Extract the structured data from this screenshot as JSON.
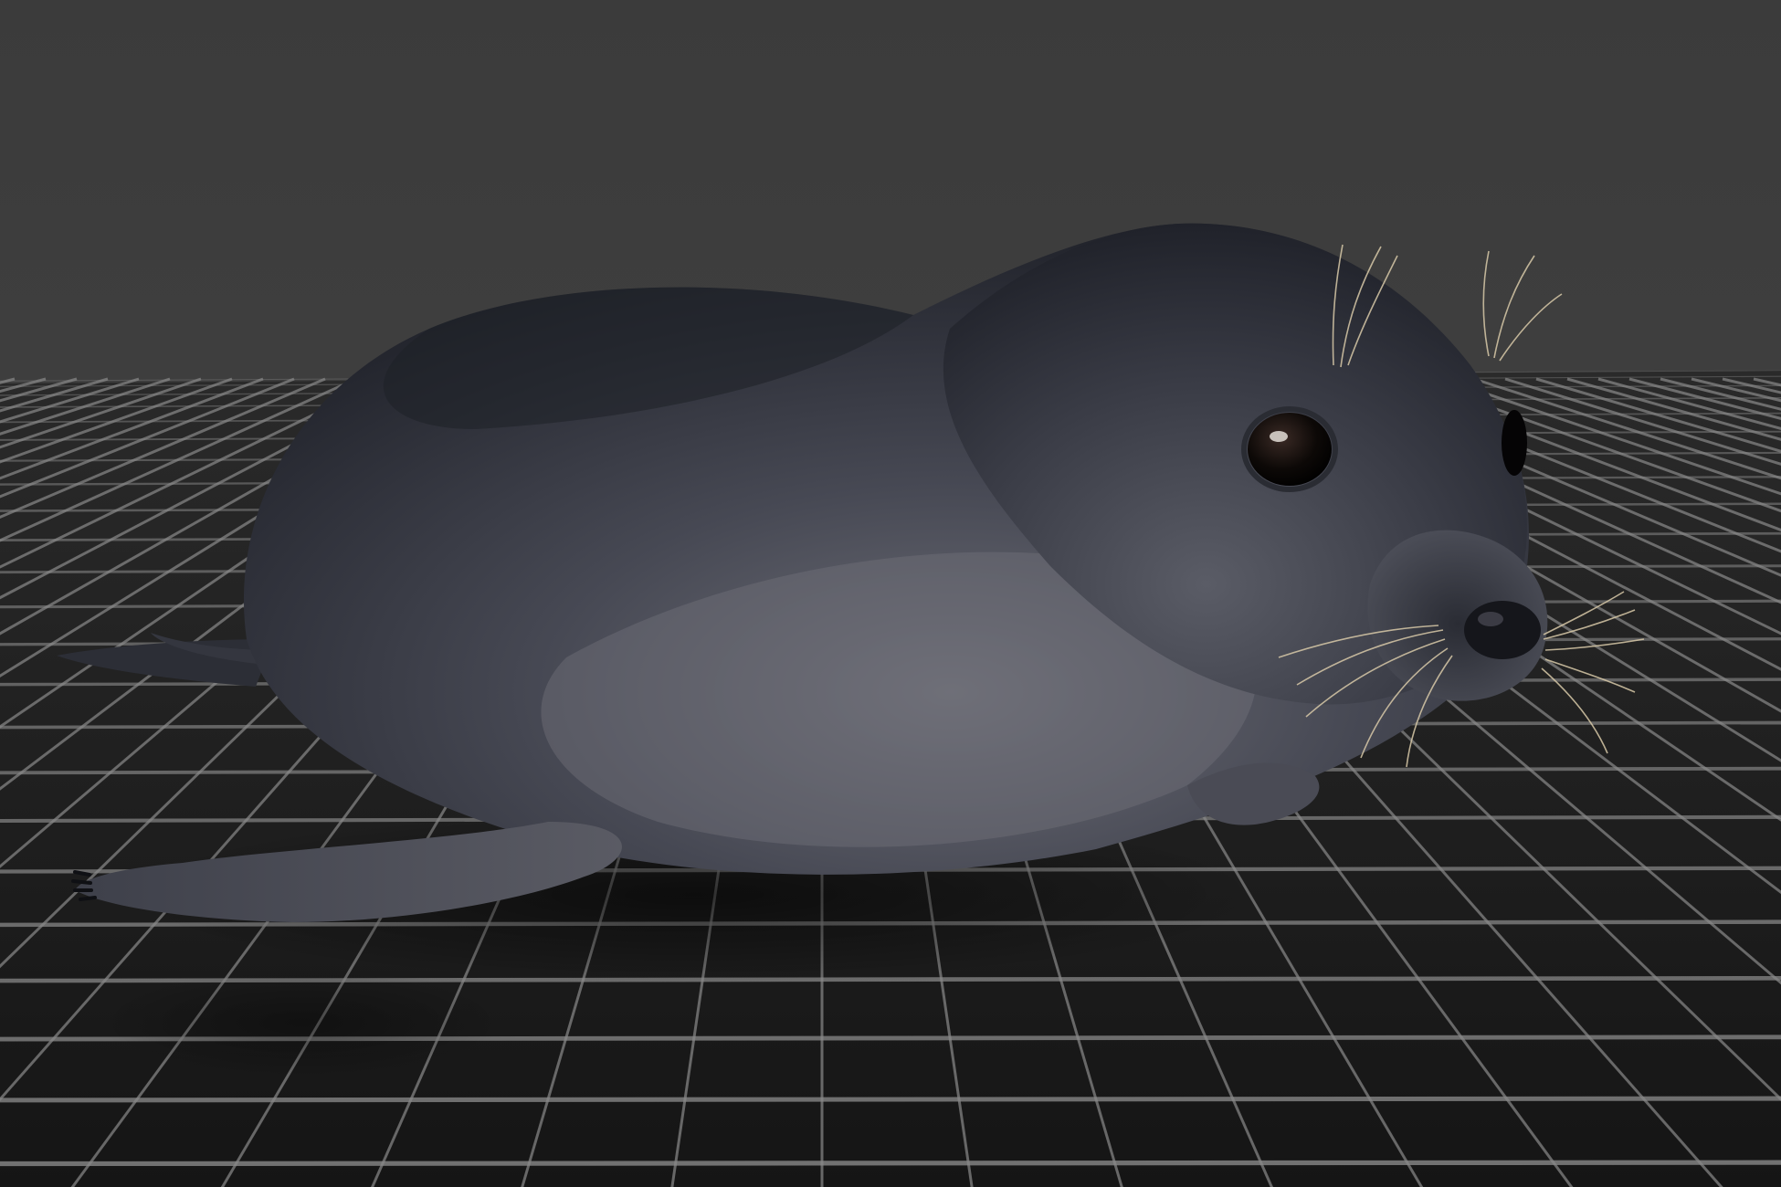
{
  "scene": {
    "subject": "seal",
    "colors": {
      "background_top": "#3c3c3c",
      "background_horizon": "#444444",
      "floor": "#1d1d1d",
      "grid_line": "#8a8a8a",
      "body_dark": "#23252d",
      "body_mid": "#3b3d47",
      "body_light": "#6a6b73",
      "whisker": "#d8c9a8"
    }
  }
}
